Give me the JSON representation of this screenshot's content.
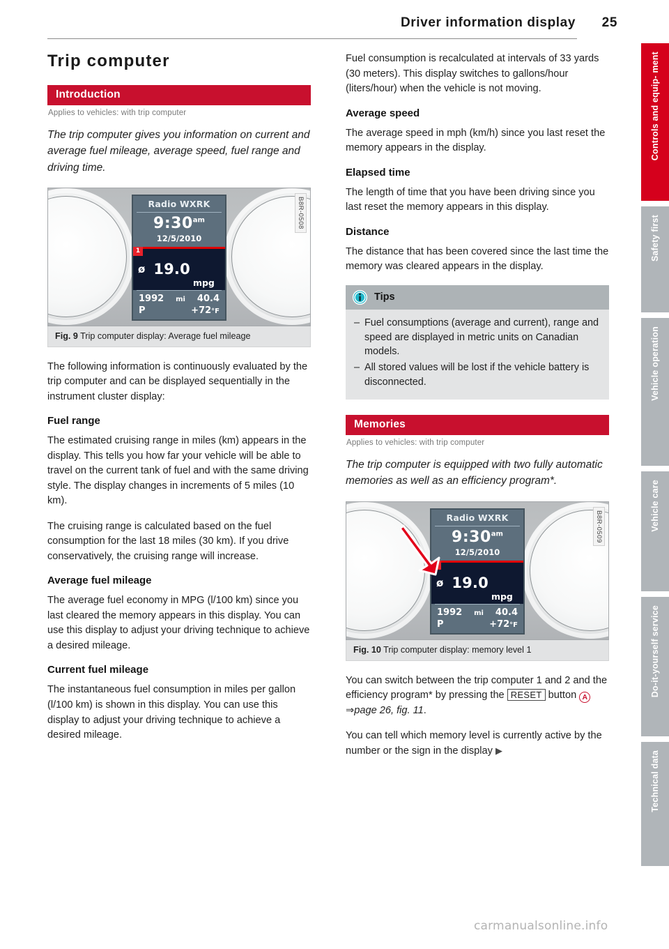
{
  "header": {
    "title": "Driver information display",
    "page_number": "25"
  },
  "left_column": {
    "chapter_title": "Trip computer",
    "section_bar": "Introduction",
    "applies_to": "Applies to vehicles: with trip computer",
    "intro_italic": "The trip computer gives you information on current and average fuel mileage, average speed, fuel range and driving time.",
    "figure": {
      "code": "B8R-0508",
      "caption_label": "Fig. 9",
      "caption_text": "Trip computer display: Average fuel mileage",
      "display": {
        "radio": "Radio WXRK",
        "time": "9:30",
        "time_suffix": "am",
        "date": "12/5/2010",
        "memory_badge": "1",
        "avg_symbol": "ø",
        "value": "19.0",
        "unit": "mpg",
        "odometer": "1992",
        "distance_unit": "mi",
        "trip_distance": "40.4",
        "gear": "P",
        "temperature": "+72",
        "temperature_unit": "°F"
      }
    },
    "para_following": "The following information is continuously evaluated by the trip computer and can be displayed sequentially in the instrument cluster display:",
    "heading_fuel_range": "Fuel range",
    "para_fuel_range_1": "The estimated cruising range in miles (km) appears in the display. This tells you how far your vehicle will be able to travel on the current tank of fuel and with the same driving style. The display changes in increments of 5 miles (10 km).",
    "para_fuel_range_2": "The cruising range is calculated based on the fuel consumption for the last 18 miles (30 km). If you drive conservatively, the cruising range will increase.",
    "heading_avg_mileage": "Average fuel mileage",
    "para_avg_mileage": "The average fuel economy in MPG (l/100 km) since you last cleared the memory appears in this display. You can use this display to adjust your driving technique to achieve a desired mileage.",
    "heading_current_mileage": "Current fuel mileage",
    "para_current_mileage": "The instantaneous fuel consumption in miles per gallon (l/100 km) is shown in this display. You can use this display to adjust your driving technique to achieve a desired mileage."
  },
  "right_column": {
    "para_fuel_consumption": "Fuel consumption is recalculated at intervals of 33 yards (30 meters). This display switches to gallons/hour (liters/hour) when the vehicle is not moving.",
    "heading_avg_speed": "Average speed",
    "para_avg_speed": "The average speed in mph (km/h) since you last reset the memory appears in the display.",
    "heading_elapsed_time": "Elapsed time",
    "para_elapsed_time": "The length of time that you have been driving since you last reset the memory appears in this display.",
    "heading_distance": "Distance",
    "para_distance": "The distance that has been covered since the last time the memory was cleared appears in the display.",
    "tips": {
      "title": "Tips",
      "items": [
        "Fuel consumptions (average and current), range and speed are displayed in metric units on Canadian models.",
        "All stored values will be lost if the vehicle battery is disconnected."
      ],
      "dash": "–"
    },
    "memories_bar": "Memories",
    "memories_applies_to": "Applies to vehicles: with trip computer",
    "memories_italic": "The trip computer is equipped with two fully automatic memories as well as an efficiency program*.",
    "figure": {
      "code": "B8R-0509",
      "caption_label": "Fig. 10",
      "caption_text": "Trip computer display: memory level 1",
      "display": {
        "radio": "Radio WXRK",
        "time": "9:30",
        "time_suffix": "am",
        "date": "12/5/2010",
        "memory_badge": "1",
        "avg_symbol": "ø",
        "value": "19.0",
        "unit": "mpg",
        "odometer": "1992",
        "distance_unit": "mi",
        "trip_distance": "40.4",
        "gear": "P",
        "temperature": "+72",
        "temperature_unit": "°F"
      }
    },
    "para_switch_1": "You can switch between the trip computer 1 and 2 and the efficiency program* by pressing the ",
    "reset_button_label": "RESET",
    "para_switch_2": " button ",
    "reference_marker": "A",
    "reference_arrow": "⇒",
    "reference_text": "page 26, fig. 11",
    "para_switch_3": ".",
    "para_memory_level": "You can tell which memory level is currently active by the number or the sign in the display",
    "continuation_arrow": "▶"
  },
  "side_tabs": [
    {
      "label": "Controls and equip-\nment",
      "active": true
    },
    {
      "label": "Safety first",
      "active": false
    },
    {
      "label": "Vehicle operation",
      "active": false
    },
    {
      "label": "Vehicle care",
      "active": false
    },
    {
      "label": "Do-it-yourself\nservice",
      "active": false
    },
    {
      "label": "Technical data",
      "active": false
    }
  ],
  "watermark": "carmanualsonline.info",
  "colors": {
    "brand_red": "#c8102e",
    "tab_red": "#d5001c",
    "tab_gray": "#b0b5b9",
    "tips_header": "#adb3b6",
    "tips_body": "#e3e4e5",
    "display_bg": "#5d6f7d",
    "display_dark": "#0e1830"
  }
}
